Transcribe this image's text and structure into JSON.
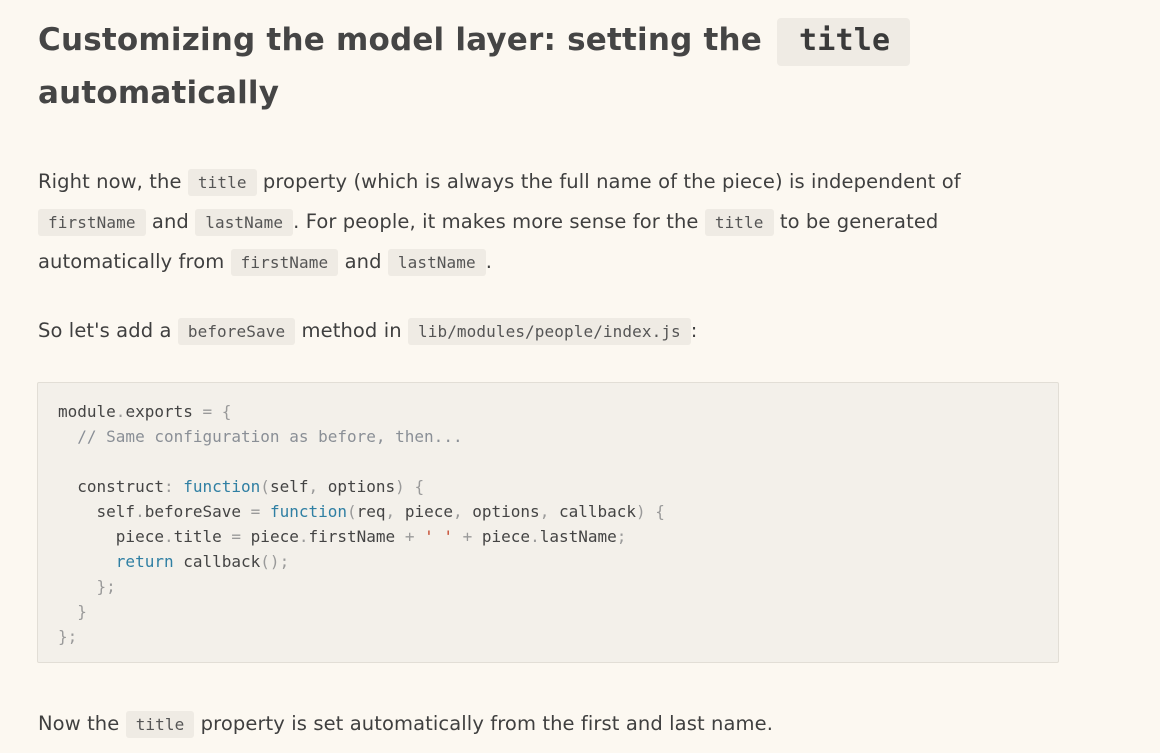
{
  "heading": {
    "prefix": "Customizing the model layer: setting the",
    "code": "title",
    "suffix": "automatically"
  },
  "para1": {
    "t1": "Right now, the",
    "c1": "title",
    "t2": "property (which is always the full name of the piece) is independent of",
    "c2": "firstName",
    "t3": "and",
    "c3": "lastName",
    "t4": ". For people, it makes more sense for the",
    "c4": "title",
    "t5": "to be generated automatically from",
    "c5": "firstName",
    "t6": "and",
    "c6": "lastName",
    "t7": "."
  },
  "para2": {
    "t1": "So let's add a",
    "c1": "beforeSave",
    "t2": "method in",
    "c2": "lib/modules/people/index.js",
    "t3": ":"
  },
  "code_block": {
    "lines": [
      [
        [
          "plain",
          "module"
        ],
        [
          "punc",
          "."
        ],
        [
          "plain",
          "exports "
        ],
        [
          "punc",
          "= {"
        ]
      ],
      [
        [
          "plain",
          "  "
        ],
        [
          "comment",
          "// Same configuration as before, then..."
        ]
      ],
      [],
      [
        [
          "plain",
          "  construct"
        ],
        [
          "punc",
          ": "
        ],
        [
          "kw",
          "function"
        ],
        [
          "punc",
          "("
        ],
        [
          "plain",
          "self"
        ],
        [
          "punc",
          ", "
        ],
        [
          "plain",
          "options"
        ],
        [
          "punc",
          ") {"
        ]
      ],
      [
        [
          "plain",
          "    self"
        ],
        [
          "punc",
          "."
        ],
        [
          "plain",
          "beforeSave "
        ],
        [
          "punc",
          "= "
        ],
        [
          "kw",
          "function"
        ],
        [
          "punc",
          "("
        ],
        [
          "plain",
          "req"
        ],
        [
          "punc",
          ", "
        ],
        [
          "plain",
          "piece"
        ],
        [
          "punc",
          ", "
        ],
        [
          "plain",
          "options"
        ],
        [
          "punc",
          ", "
        ],
        [
          "plain",
          "callback"
        ],
        [
          "punc",
          ") {"
        ]
      ],
      [
        [
          "plain",
          "      piece"
        ],
        [
          "punc",
          "."
        ],
        [
          "plain",
          "title "
        ],
        [
          "punc",
          "= "
        ],
        [
          "plain",
          "piece"
        ],
        [
          "punc",
          "."
        ],
        [
          "plain",
          "firstName "
        ],
        [
          "punc",
          "+ "
        ],
        [
          "str",
          "' '"
        ],
        [
          "punc",
          " + "
        ],
        [
          "plain",
          "piece"
        ],
        [
          "punc",
          "."
        ],
        [
          "plain",
          "lastName"
        ],
        [
          "punc",
          ";"
        ]
      ],
      [
        [
          "plain",
          "      "
        ],
        [
          "kw",
          "return"
        ],
        [
          "plain",
          " callback"
        ],
        [
          "punc",
          "();"
        ]
      ],
      [
        [
          "punc",
          "    };"
        ]
      ],
      [
        [
          "punc",
          "  }"
        ]
      ],
      [
        [
          "punc",
          "};"
        ]
      ]
    ]
  },
  "para3": {
    "t1": "Now the",
    "c1": "title",
    "t2": "property is set automatically from the first and last name."
  }
}
